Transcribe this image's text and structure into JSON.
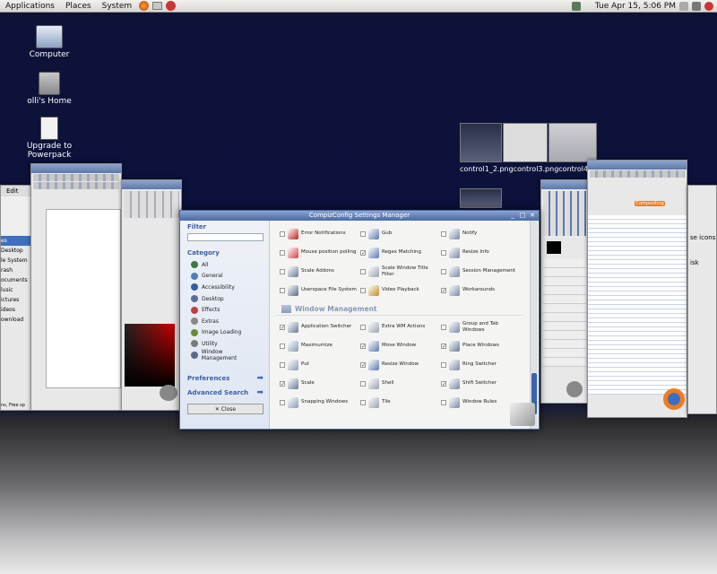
{
  "panel": {
    "menus": [
      "Applications",
      "Places",
      "System"
    ],
    "clock": "Tue Apr 15,  5:06 PM"
  },
  "desktop": {
    "icons": [
      {
        "label": "Computer"
      },
      {
        "label": "olli's Home"
      },
      {
        "label": "Upgrade to Powerpack"
      }
    ]
  },
  "thumbnails": {
    "label": "control1_2.pngcontrol3.pngcontrol4.png"
  },
  "ccsm": {
    "title": "CompizConfig Settings Manager",
    "filter_label": "Filter",
    "category_label": "Category",
    "categories": [
      {
        "label": "All",
        "color": "#3c7a3c"
      },
      {
        "label": "General",
        "color": "#4a7fc0"
      },
      {
        "label": "Accessibility",
        "color": "#2e5fa8"
      },
      {
        "label": "Desktop",
        "color": "#5a6e9a"
      },
      {
        "label": "Effects",
        "color": "#c04040"
      },
      {
        "label": "Extras",
        "color": "#888888"
      },
      {
        "label": "Image Loading",
        "color": "#6a8a3a"
      },
      {
        "label": "Utility",
        "color": "#7a7a7a"
      },
      {
        "label": "Window Management",
        "color": "#5a6a8a"
      }
    ],
    "preferences_label": "Preferences",
    "advanced_search_label": "Advanced Search",
    "close_label": "Close",
    "top_plugins": [
      {
        "name": "Error Notifications",
        "checked": false,
        "color": "#c02020"
      },
      {
        "name": "Gub",
        "checked": false,
        "color": "#5a7ab0"
      },
      {
        "name": "Notify",
        "checked": false,
        "color": "#7a8aa8"
      },
      {
        "name": "Mouse position polling",
        "checked": false,
        "color": "#d04040"
      },
      {
        "name": "Regex Matching",
        "checked": true,
        "color": "#5a7ab0"
      },
      {
        "name": "Resize Info",
        "checked": false,
        "color": "#7a8aa8"
      },
      {
        "name": "Scale Addons",
        "checked": false,
        "color": "#6a7a98"
      },
      {
        "name": "Scale Window Title Filter",
        "checked": false,
        "color": "#9aa0b0"
      },
      {
        "name": "Session Management",
        "checked": false,
        "color": "#7a8aa8"
      },
      {
        "name": "Userspace File System",
        "checked": false,
        "color": "#5a6a8a"
      },
      {
        "name": "Video Playback",
        "checked": false,
        "color": "#c09020"
      },
      {
        "name": "Workarounds",
        "checked": true,
        "color": "#7a8aa8"
      }
    ],
    "section_title": "Window Management",
    "wm_plugins": [
      {
        "name": "Application Switcher",
        "checked": true,
        "color": "#6a7a98"
      },
      {
        "name": "Extra WM Actions",
        "checked": false,
        "color": "#9aa0b0"
      },
      {
        "name": "Group and Tab Windows",
        "checked": false,
        "color": "#7a8aa8"
      },
      {
        "name": "Maximumize",
        "checked": false,
        "color": "#8a9ab8"
      },
      {
        "name": "Move Window",
        "checked": true,
        "color": "#5a7ab0"
      },
      {
        "name": "Place Windows",
        "checked": true,
        "color": "#6a7a98"
      },
      {
        "name": "Put",
        "checked": false,
        "color": "#8a9ab8"
      },
      {
        "name": "Resize Window",
        "checked": true,
        "color": "#5a7ab0"
      },
      {
        "name": "Ring Switcher",
        "checked": false,
        "color": "#7a8aa8"
      },
      {
        "name": "Scale",
        "checked": true,
        "color": "#6a7a98"
      },
      {
        "name": "Shell",
        "checked": false,
        "color": "#9aa0b0"
      },
      {
        "name": "Shift Switcher",
        "checked": true,
        "color": "#7a8aa8"
      },
      {
        "name": "Snapping Windows",
        "checked": false,
        "color": "#8a9ab8"
      },
      {
        "name": "Tile",
        "checked": false,
        "color": "#9aa0b0"
      },
      {
        "name": "Window Rules",
        "checked": false,
        "color": "#7a8aa8"
      }
    ]
  },
  "left_window": {
    "menu": [
      "Edit"
    ],
    "side_items": [
      "es",
      "Desktop",
      "le System",
      "rash",
      "ocuments",
      "lusic",
      "ictures",
      "ideos",
      "ownload"
    ],
    "status": "ns, Free sp"
  },
  "right_window": {
    "text": [
      "se icons",
      "isk"
    ],
    "tab_label": "Compositing"
  }
}
